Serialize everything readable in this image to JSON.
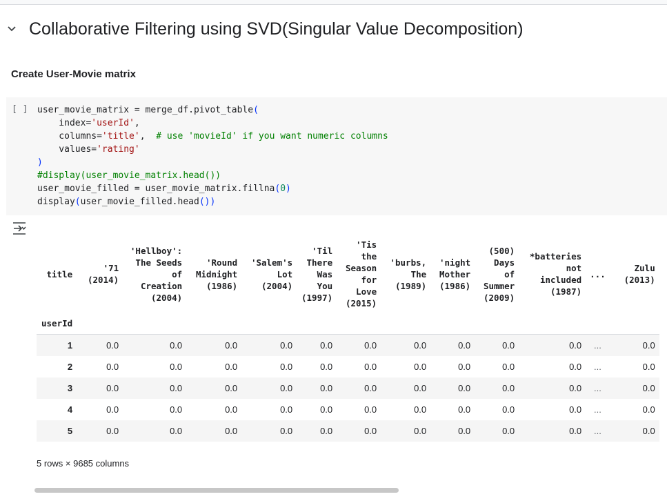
{
  "section": {
    "title": "Collaborative Filtering using SVD(Singular Value Decomposition)"
  },
  "subheading": "Create User-Movie matrix",
  "cell": {
    "run_label": "[ ]",
    "lines": [
      "user_movie_matrix = merge_df.pivot_table(",
      "    index='userId',",
      "    columns='title',  # use 'movieId' if you want numeric columns",
      "    values='rating'",
      ")",
      "#display(user_movie_matrix.head())",
      "user_movie_filled = user_movie_matrix.fillna(0)",
      "display(user_movie_filled.head())"
    ]
  },
  "output": {
    "columns_label": "title",
    "index_label": "userId",
    "columns": [
      "'71\n(2014)",
      "'Hellboy':\nThe Seeds\nof\nCreation\n(2004)",
      "'Round\nMidnight\n(1986)",
      "'Salem's\nLot\n(2004)",
      "'Til\nThere\nWas\nYou\n(1997)",
      "'Tis\nthe\nSeason\nfor\nLove\n(2015)",
      "'burbs,\nThe\n(1989)",
      "'night\nMother\n(1986)",
      "(500)\nDays\nof\nSummer\n(2009)",
      "*batteries\nnot\nincluded\n(1987)",
      "...",
      "Zulu\n(2013)"
    ],
    "rows": [
      {
        "id": "1",
        "values": [
          "0.0",
          "0.0",
          "0.0",
          "0.0",
          "0.0",
          "0.0",
          "0.0",
          "0.0",
          "0.0",
          "0.0",
          "...",
          "0.0"
        ]
      },
      {
        "id": "2",
        "values": [
          "0.0",
          "0.0",
          "0.0",
          "0.0",
          "0.0",
          "0.0",
          "0.0",
          "0.0",
          "0.0",
          "0.0",
          "...",
          "0.0"
        ]
      },
      {
        "id": "3",
        "values": [
          "0.0",
          "0.0",
          "0.0",
          "0.0",
          "0.0",
          "0.0",
          "0.0",
          "0.0",
          "0.0",
          "0.0",
          "...",
          "0.0"
        ]
      },
      {
        "id": "4",
        "values": [
          "0.0",
          "0.0",
          "0.0",
          "0.0",
          "0.0",
          "0.0",
          "0.0",
          "0.0",
          "0.0",
          "0.0",
          "...",
          "0.0"
        ]
      },
      {
        "id": "5",
        "values": [
          "0.0",
          "0.0",
          "0.0",
          "0.0",
          "0.0",
          "0.0",
          "0.0",
          "0.0",
          "0.0",
          "0.0",
          "...",
          "0.0"
        ]
      }
    ],
    "caption": "5 rows × 9685 columns"
  }
}
